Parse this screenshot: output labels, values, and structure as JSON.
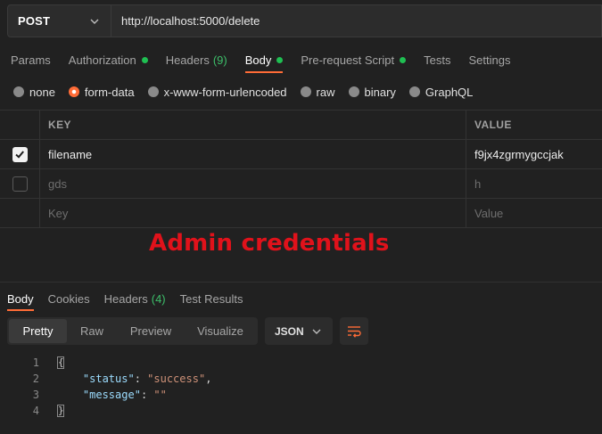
{
  "request": {
    "method": "POST",
    "url": "http://localhost:5000/delete"
  },
  "request_tabs": [
    {
      "label": "Params",
      "active": false,
      "dot": false,
      "count": ""
    },
    {
      "label": "Authorization",
      "active": false,
      "dot": true,
      "count": ""
    },
    {
      "label": "Headers",
      "active": false,
      "dot": false,
      "count": "(9)"
    },
    {
      "label": "Body",
      "active": true,
      "dot": true,
      "count": ""
    },
    {
      "label": "Pre-request Script",
      "active": false,
      "dot": true,
      "count": ""
    },
    {
      "label": "Tests",
      "active": false,
      "dot": false,
      "count": ""
    },
    {
      "label": "Settings",
      "active": false,
      "dot": false,
      "count": ""
    }
  ],
  "body_types": [
    {
      "label": "none",
      "selected": false
    },
    {
      "label": "form-data",
      "selected": true
    },
    {
      "label": "x-www-form-urlencoded",
      "selected": false
    },
    {
      "label": "raw",
      "selected": false
    },
    {
      "label": "binary",
      "selected": false
    },
    {
      "label": "GraphQL",
      "selected": false
    }
  ],
  "params_table": {
    "headers": {
      "key": "KEY",
      "value": "VALUE"
    },
    "rows": [
      {
        "checked": true,
        "key": "filename",
        "value": "f9jx4zgrmygccjak"
      },
      {
        "checked": false,
        "key": "gds",
        "value": "h"
      }
    ],
    "placeholder": {
      "key": "Key",
      "value": "Value"
    }
  },
  "caption": "Admin credentials",
  "response_tabs": [
    {
      "label": "Body",
      "active": true,
      "count": ""
    },
    {
      "label": "Cookies",
      "active": false,
      "count": ""
    },
    {
      "label": "Headers",
      "active": false,
      "count": "(4)"
    },
    {
      "label": "Test Results",
      "active": false,
      "count": ""
    }
  ],
  "view_modes": [
    {
      "label": "Pretty",
      "active": true
    },
    {
      "label": "Raw",
      "active": false
    },
    {
      "label": "Preview",
      "active": false
    },
    {
      "label": "Visualize",
      "active": false
    }
  ],
  "format": "JSON",
  "response_code": {
    "line_numbers": [
      "1",
      "2",
      "3",
      "4"
    ],
    "status_key": "\"status\"",
    "status_value": "\"success\"",
    "message_key": "\"message\"",
    "message_value": "\"\""
  },
  "colors": {
    "accent": "#ff6c37",
    "status_dot": "#1fbf52",
    "caption": "#e0121b"
  }
}
